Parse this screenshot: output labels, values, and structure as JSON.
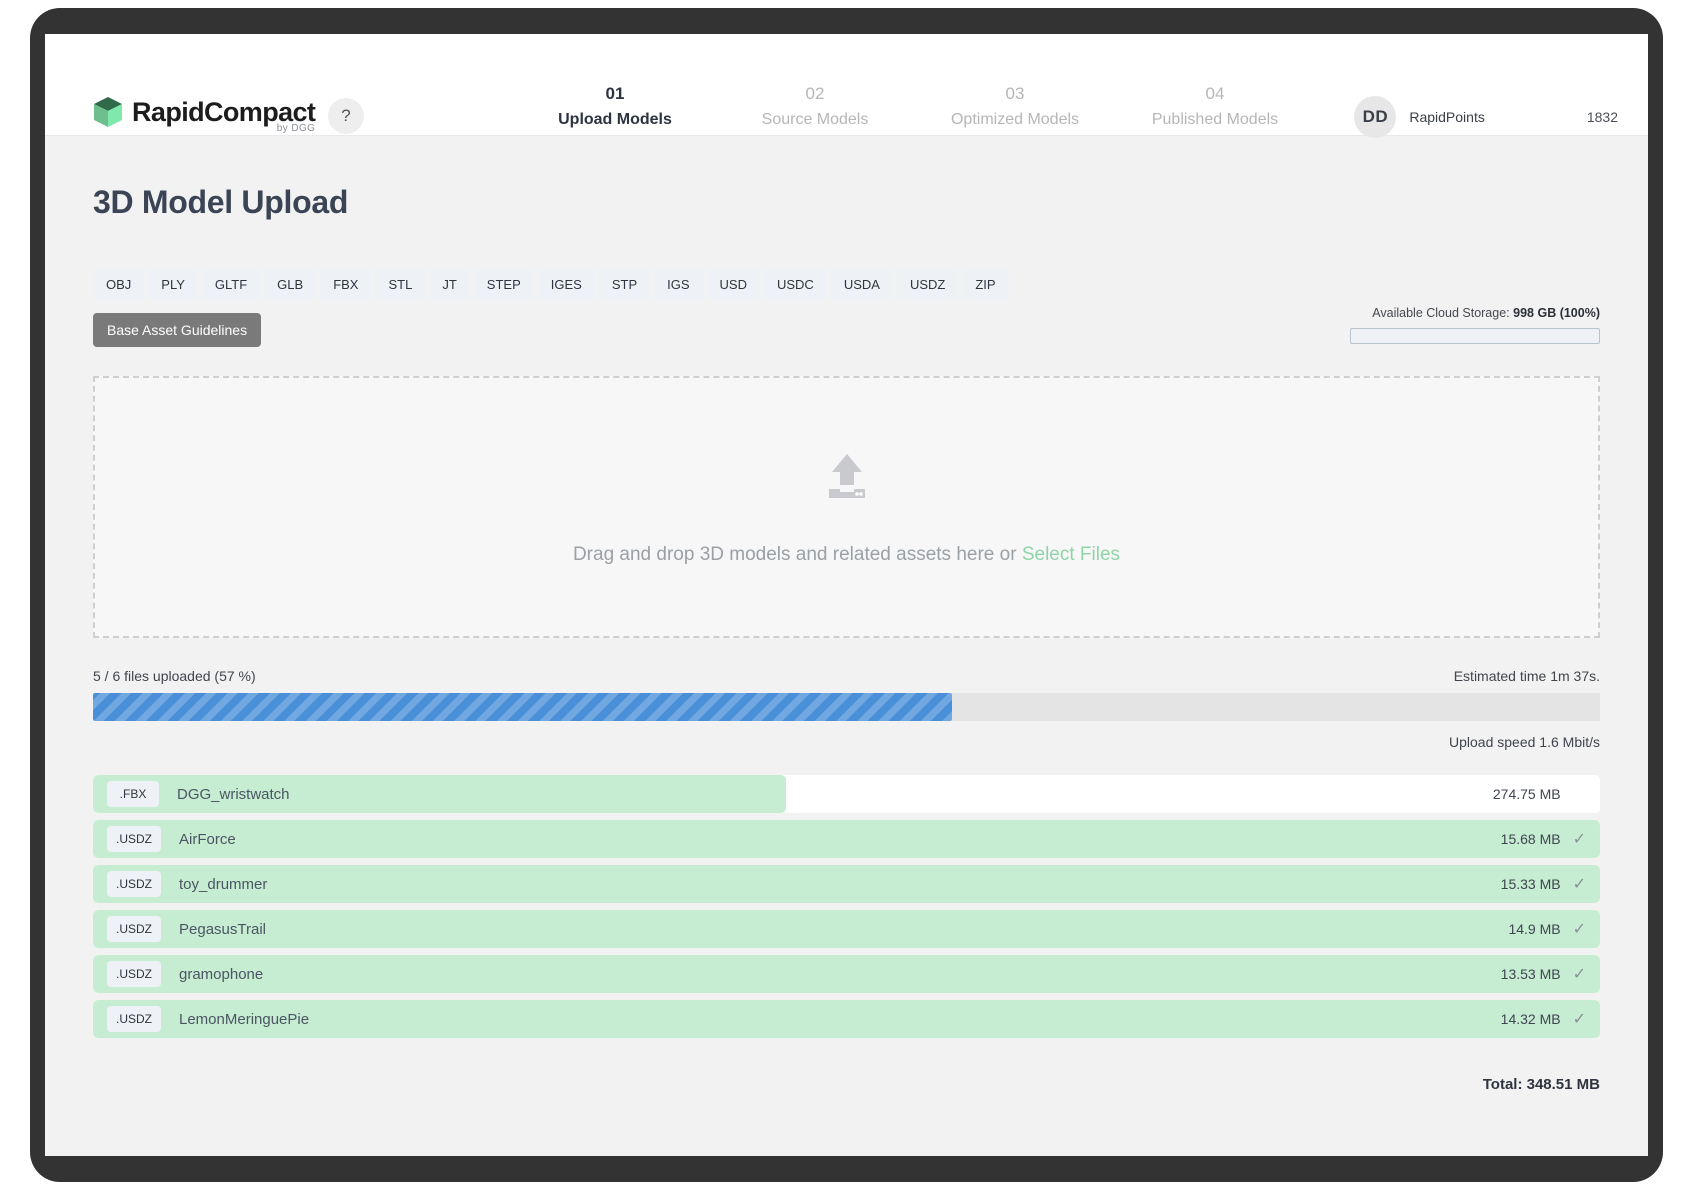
{
  "header": {
    "brand": "RapidCompact",
    "brand_sub": "by DGG",
    "help_label": "?",
    "steps": [
      {
        "num": "01",
        "label": "Upload Models",
        "active": true
      },
      {
        "num": "02",
        "label": "Source Models",
        "active": false
      },
      {
        "num": "03",
        "label": "Optimized Models",
        "active": false
      },
      {
        "num": "04",
        "label": "Published Models",
        "active": false
      }
    ],
    "avatar_initials": "DD",
    "points_label": "RapidPoints",
    "points_value": "1832"
  },
  "page": {
    "title": "3D Model Upload"
  },
  "formats": [
    "OBJ",
    "PLY",
    "GLTF",
    "GLB",
    "FBX",
    "STL",
    "JT",
    "STEP",
    "IGES",
    "STP",
    "IGS",
    "USD",
    "USDC",
    "USDA",
    "USDZ",
    "ZIP"
  ],
  "guidelines_button": "Base Asset Guidelines",
  "storage": {
    "label": "Available Cloud Storage:",
    "value": "998 GB (100%)",
    "fill_percent": 0
  },
  "dropzone": {
    "text": "Drag and drop 3D models and related assets here or",
    "link": "Select Files",
    "icon": "upload-icon"
  },
  "progress": {
    "status": "5 / 6 files uploaded (57 %)",
    "estimated": "Estimated time 1m 37s.",
    "speed": "Upload speed 1.6 Mbit/s",
    "percent": 57
  },
  "files": [
    {
      "ext": ".FBX",
      "name": "DGG_wristwatch",
      "size": "274.75 MB",
      "progress": 46,
      "done": false
    },
    {
      "ext": ".USDZ",
      "name": "AirForce",
      "size": "15.68 MB",
      "progress": 100,
      "done": true
    },
    {
      "ext": ".USDZ",
      "name": "toy_drummer",
      "size": "15.33 MB",
      "progress": 100,
      "done": true
    },
    {
      "ext": ".USDZ",
      "name": "PegasusTrail",
      "size": "14.9 MB",
      "progress": 100,
      "done": true
    },
    {
      "ext": ".USDZ",
      "name": "gramophone",
      "size": "13.53 MB",
      "progress": 100,
      "done": true
    },
    {
      "ext": ".USDZ",
      "name": "LemonMeringuePie",
      "size": "14.32 MB",
      "progress": 100,
      "done": true
    }
  ],
  "total": "Total: 348.51 MB",
  "colors": {
    "accent_green": "#8fd4a8",
    "progress_blue": "#4a90d9",
    "file_green": "#c6edd2",
    "title": "#3b4455"
  }
}
